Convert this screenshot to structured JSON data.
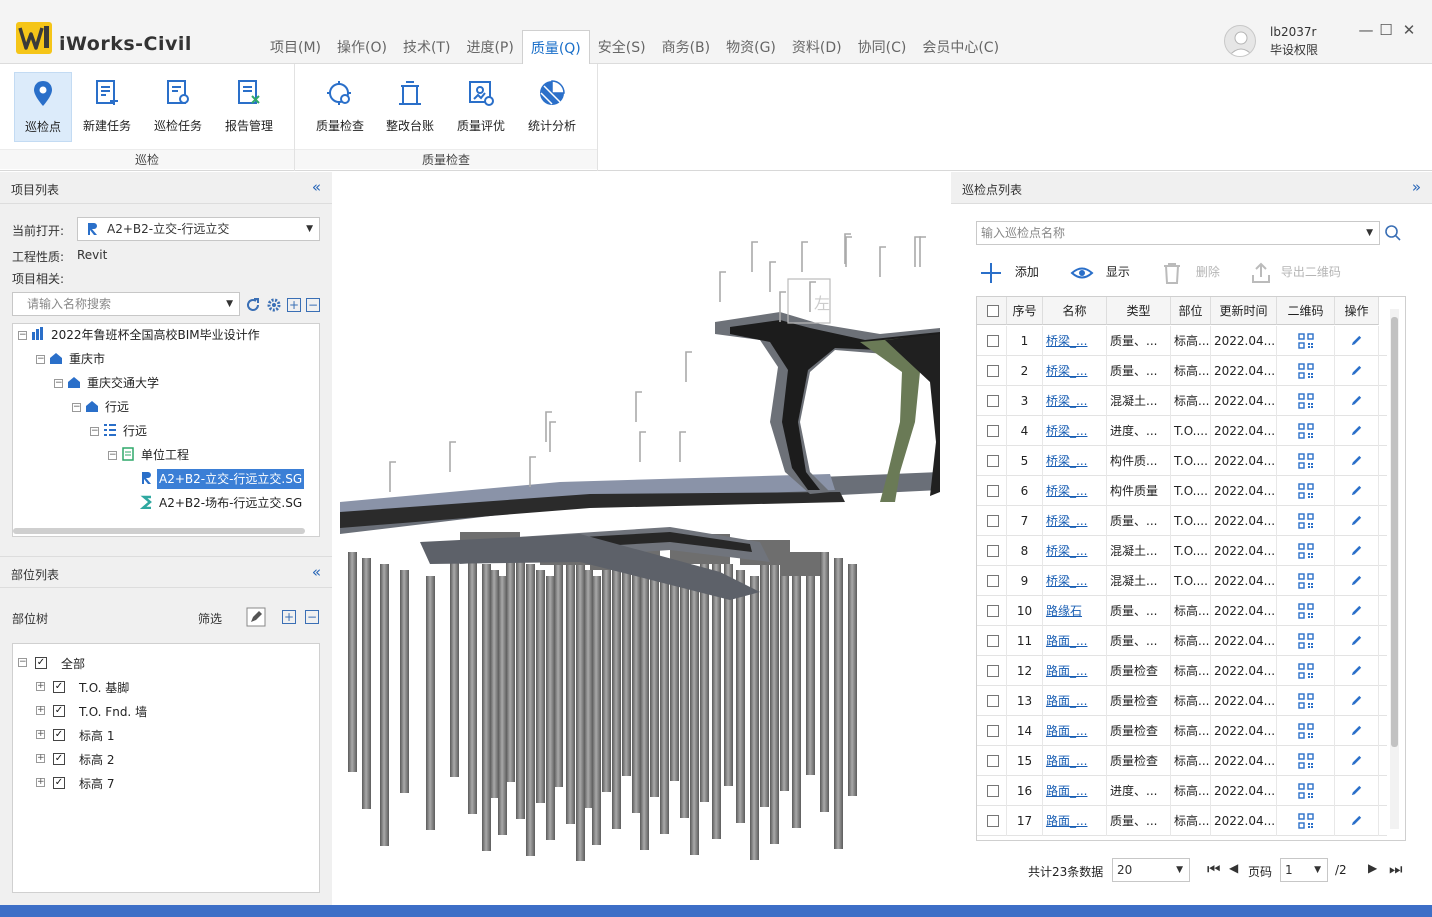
{
  "app": {
    "title": "iWorks-Civil"
  },
  "menu": [
    {
      "label": "项目(M)"
    },
    {
      "label": "操作(O)"
    },
    {
      "label": "技术(T)"
    },
    {
      "label": "进度(P)"
    },
    {
      "label": "质量(Q)",
      "active": true
    },
    {
      "label": "安全(S)"
    },
    {
      "label": "商务(B)"
    },
    {
      "label": "物资(G)"
    },
    {
      "label": "资料(D)"
    },
    {
      "label": "协同(C)"
    },
    {
      "label": "会员中心(C)"
    }
  ],
  "user": {
    "name": "lb2037r",
    "role": "毕设权限"
  },
  "window": {
    "minimize": "—",
    "maximize": "☐",
    "close": "✕"
  },
  "ribbon": {
    "groups": [
      {
        "label": "巡检",
        "buttons": [
          "巡检点",
          "新建任务",
          "巡检任务",
          "报告管理"
        ]
      },
      {
        "label": "质量检查",
        "buttons": [
          "质量检查",
          "整改台账",
          "质量评优",
          "统计分析"
        ]
      }
    ]
  },
  "project_panel": {
    "title": "项目列表",
    "collapse": "«",
    "current_label": "当前打开:",
    "current_value": "A2+B2-立交-行远立交",
    "type_label": "工程性质:",
    "type_value": "Revit",
    "related_label": "项目相关:",
    "search_placeholder": "请输入名称搜索",
    "tree": [
      "2022年鲁班杯全国高校BIM毕业设计作",
      "重庆市",
      "重庆交通大学",
      "行远",
      "行远",
      "单位工程",
      "A2+B2-立交-行远立交.SG",
      "A2+B2-场布-行远立交.SG"
    ]
  },
  "part_panel": {
    "title": "部位列表",
    "collapse": "«",
    "tree_label": "部位树",
    "filter_label": "筛选",
    "items": [
      "全部",
      "T.O. 基脚",
      "T.O. Fnd. 墙",
      "标高 1",
      "标高 2",
      "标高 7"
    ]
  },
  "viewport": {
    "cube_label": "左"
  },
  "checkpoint_panel": {
    "title": "巡检点列表",
    "collapse": "»",
    "search_placeholder": "输入巡检点名称",
    "toolbar": {
      "add": "添加",
      "show": "显示",
      "delete": "删除",
      "export_qr": "导出二维码"
    },
    "columns": [
      "序号",
      "名称",
      "类型",
      "部位",
      "更新时间",
      "二维码",
      "操作"
    ],
    "rows": [
      {
        "no": "1",
        "name": "桥梁_...",
        "type": "质量、...",
        "part": "标高...",
        "time": "2022.04...."
      },
      {
        "no": "2",
        "name": "桥梁_...",
        "type": "质量、...",
        "part": "标高...",
        "time": "2022.04...."
      },
      {
        "no": "3",
        "name": "桥梁_...",
        "type": "混凝土...",
        "part": "标高...",
        "time": "2022.04...."
      },
      {
        "no": "4",
        "name": "桥梁_...",
        "type": "进度、...",
        "part": "T.O....",
        "time": "2022.04...."
      },
      {
        "no": "5",
        "name": "桥梁_...",
        "type": "构件质...",
        "part": "T.O....",
        "time": "2022.04...."
      },
      {
        "no": "6",
        "name": "桥梁_...",
        "type": "构件质量",
        "part": "T.O....",
        "time": "2022.04...."
      },
      {
        "no": "7",
        "name": "桥梁_...",
        "type": "质量、...",
        "part": "T.O....",
        "time": "2022.04...."
      },
      {
        "no": "8",
        "name": "桥梁_...",
        "type": "混凝土...",
        "part": "T.O....",
        "time": "2022.04...."
      },
      {
        "no": "9",
        "name": "桥梁_...",
        "type": "混凝土...",
        "part": "T.O....",
        "time": "2022.04...."
      },
      {
        "no": "10",
        "name": "路缘石",
        "type": "质量、...",
        "part": "标高...",
        "time": "2022.04...."
      },
      {
        "no": "11",
        "name": "路面_...",
        "type": "质量、...",
        "part": "标高...",
        "time": "2022.04...."
      },
      {
        "no": "12",
        "name": "路面_...",
        "type": "质量检查",
        "part": "标高...",
        "time": "2022.04...."
      },
      {
        "no": "13",
        "name": "路面_...",
        "type": "质量检查",
        "part": "标高...",
        "time": "2022.04...."
      },
      {
        "no": "14",
        "name": "路面_...",
        "type": "质量检查",
        "part": "标高...",
        "time": "2022.04...."
      },
      {
        "no": "15",
        "name": "路面_...",
        "type": "质量检查",
        "part": "标高...",
        "time": "2022.04...."
      },
      {
        "no": "16",
        "name": "路面_...",
        "type": "进度、...",
        "part": "标高...",
        "time": "2022.04...."
      },
      {
        "no": "17",
        "name": "路面_...",
        "type": "质量、...",
        "part": "标高...",
        "time": "2022.04...."
      }
    ],
    "pager": {
      "total": "共计23条数据",
      "page_size": "20",
      "page_label": "页码",
      "page": "1",
      "pages": "/2"
    }
  },
  "colors": {
    "accent": "#1a6fc9",
    "selection": "#3b7fd6",
    "statusbar": "#3d6fc7",
    "link": "#1a5fb4"
  }
}
